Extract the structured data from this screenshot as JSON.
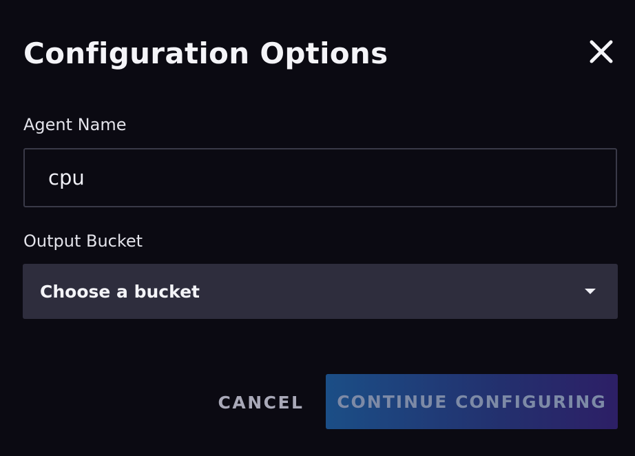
{
  "dialog": {
    "title": "Configuration Options",
    "close_icon": "close-icon"
  },
  "agent_name": {
    "label": "Agent Name",
    "value": "cpu"
  },
  "output_bucket": {
    "label": "Output Bucket",
    "selected": "Choose a bucket",
    "caret_icon": "caret-down-icon"
  },
  "actions": {
    "cancel_label": "CANCEL",
    "continue_label": "CONTINUE CONFIGURING"
  },
  "colors": {
    "background": "#0b0a12",
    "select_bg": "#2e2d3d",
    "continue_gradient_start": "#1b4e86",
    "continue_gradient_end": "#2d1f66",
    "continue_text_disabled": "#7d8aa6"
  }
}
